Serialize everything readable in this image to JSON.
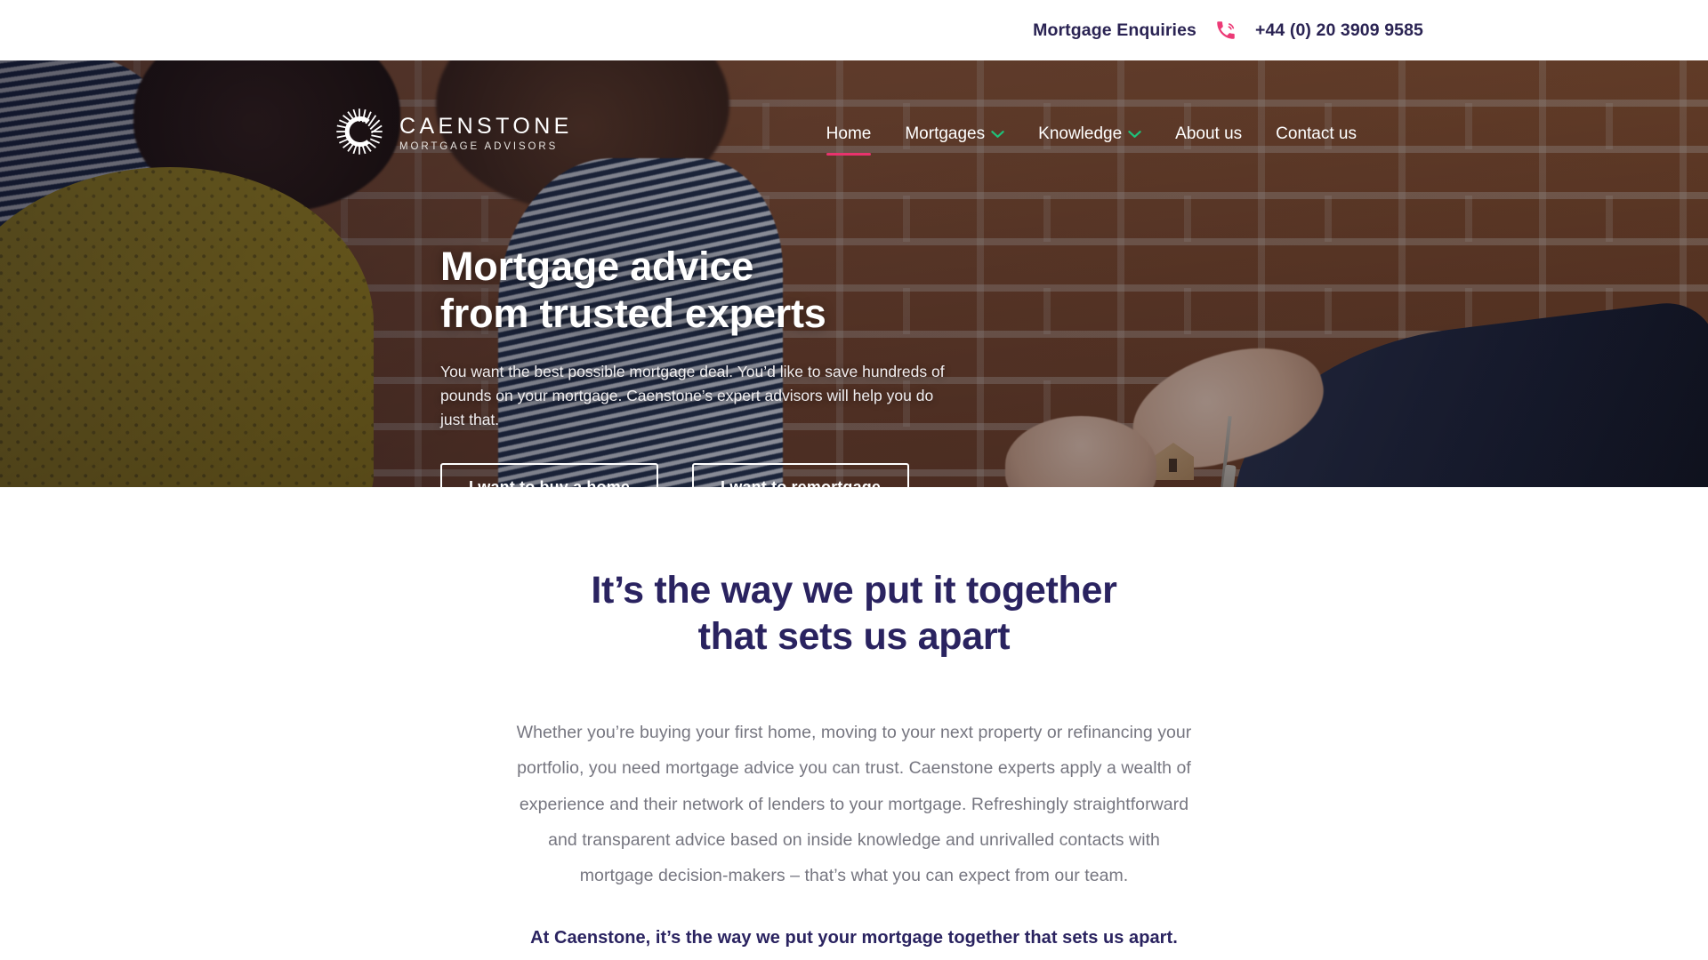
{
  "topbar": {
    "enquiries_label": "Mortgage Enquiries",
    "phone_icon": "phone-ringing-icon",
    "phone_number": "+44 (0) 20 3909 9585",
    "text_color": "#2a2353",
    "phone_icon_color": "#ec3a76"
  },
  "brand": {
    "logo_mark": "caenstone-radial-c-icon",
    "name": "CAENSTONE",
    "tagline": "MORTGAGE ADVISORS"
  },
  "nav": {
    "items": [
      {
        "label": "Home",
        "active": true,
        "has_dropdown": false
      },
      {
        "label": "Mortgages",
        "active": false,
        "has_dropdown": true
      },
      {
        "label": "Knowledge",
        "active": false,
        "has_dropdown": true
      },
      {
        "label": "About us",
        "active": false,
        "has_dropdown": false
      },
      {
        "label": "Contact us",
        "active": false,
        "has_dropdown": false
      }
    ],
    "active_underline_color": "#e8336d",
    "chevron_color": "#1ec27a",
    "chevron_icon": "chevron-down-icon"
  },
  "hero": {
    "heading_line1": "Mortgage advice",
    "heading_line2": "from trusted experts",
    "paragraph": "You want the best possible mortgage deal. You’d like to save hundreds of pounds on your mortgage. Caenstone’s expert advisors will help you do just that.",
    "button_primary": "I want to buy a home",
    "button_secondary": "I want to remortgage",
    "image_description": "Couple receiving house keys in front of a brick wall"
  },
  "main": {
    "title_line1": "It’s the way we put it together",
    "title_line2": "that sets us apart",
    "body": "Whether you’re buying your first home, moving to your next property or refinancing your portfolio, you need mortgage advice you can trust. Caenstone experts apply a wealth of experience and their network of lenders to your mortgage. Refreshingly straightforward and transparent advice based on inside knowledge and unrivalled contacts with mortgage decision-makers – that’s what you can expect from our team.",
    "closing": "At Caenstone, it’s the way we put your mortgage together that sets us apart.",
    "title_color": "#2a2360",
    "body_color": "#767680"
  }
}
